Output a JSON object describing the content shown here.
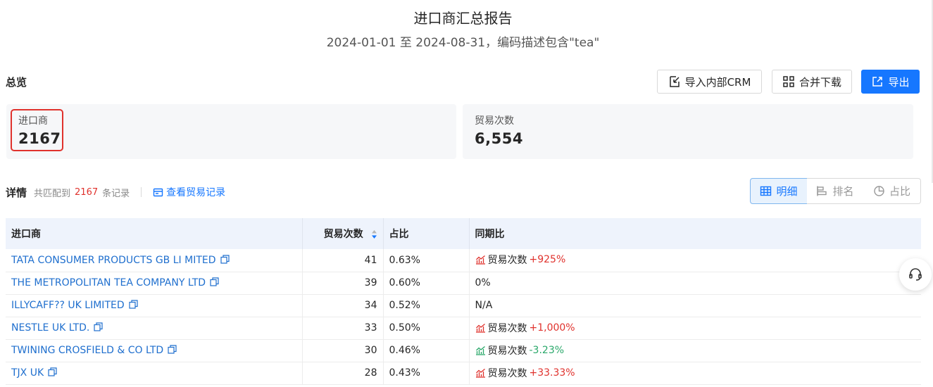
{
  "header": {
    "title": "进口商汇总报告",
    "subtitle": "2024-01-01 至 2024-08-31，编码描述包含\"tea\""
  },
  "overview": {
    "label": "总览",
    "buttons": {
      "crm": "导入内部CRM",
      "merge": "合并下载",
      "export": "导出"
    },
    "stats": [
      {
        "label": "进口商",
        "value": "2167"
      },
      {
        "label": "贸易次数",
        "value": "6,554"
      }
    ]
  },
  "details": {
    "label": "详情",
    "match_prefix": "共匹配到",
    "match_count": "2167",
    "match_suffix": "条记录",
    "view_link": "查看贸易记录",
    "view_tabs": [
      "明细",
      "排名",
      "占比"
    ]
  },
  "table": {
    "headers": [
      "进口商",
      "贸易次数",
      "占比",
      "同期比"
    ],
    "rows": [
      {
        "name": "TATA CONSUMER PRODUCTS GB LI MITED",
        "count": "41",
        "share": "0.63%",
        "trend_label": "贸易次数",
        "trend_value": "+925%",
        "trend": "up"
      },
      {
        "name": "THE METROPOLITAN TEA COMPANY LTD",
        "count": "39",
        "share": "0.60%",
        "trend_label": "",
        "trend_value": "0%",
        "trend": "none"
      },
      {
        "name": "ILLYCAFF?? UK LIMITED",
        "count": "34",
        "share": "0.52%",
        "trend_label": "",
        "trend_value": "N/A",
        "trend": "none"
      },
      {
        "name": "NESTLE UK LTD.",
        "count": "33",
        "share": "0.50%",
        "trend_label": "贸易次数",
        "trend_value": "+1,000%",
        "trend": "up"
      },
      {
        "name": "TWINING CROSFIELD & CO LTD",
        "count": "30",
        "share": "0.46%",
        "trend_label": "贸易次数",
        "trend_value": "-3.23%",
        "trend": "down"
      },
      {
        "name": "TJX UK",
        "count": "28",
        "share": "0.43%",
        "trend_label": "贸易次数",
        "trend_value": "+33.33%",
        "trend": "up"
      }
    ]
  },
  "colors": {
    "accent": "#1677ff",
    "up": "#e0322d",
    "down": "#2aa86a",
    "highlight": "#e0322d"
  },
  "icons": {
    "crm": "import-icon",
    "merge": "merge-download-icon",
    "export": "export-icon",
    "view_link": "records-icon",
    "tabs": [
      "table-icon",
      "rank-bar-icon",
      "pie-icon"
    ],
    "copy": "copy-icon",
    "float": "headset-icon"
  }
}
